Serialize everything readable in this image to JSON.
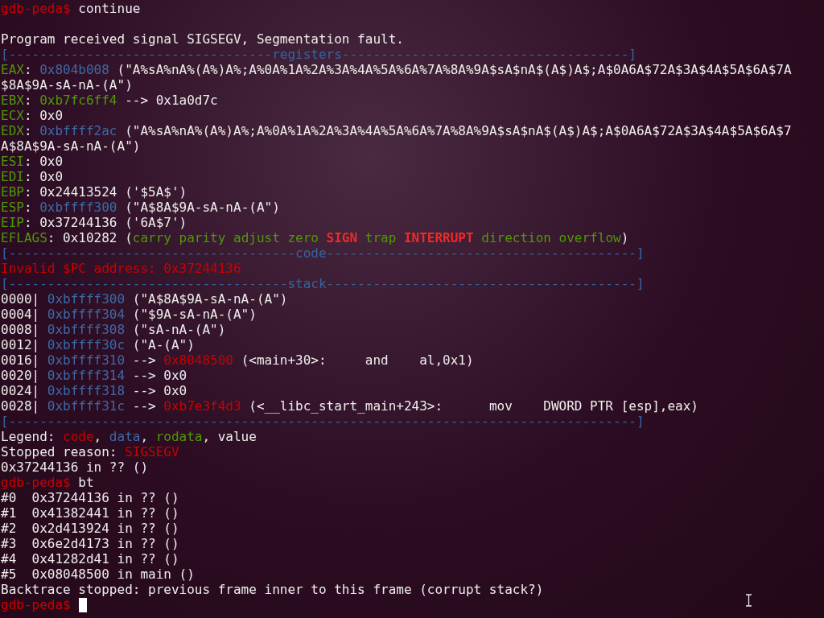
{
  "terminal": {
    "cursor_visible": true,
    "lines": [
      {
        "kind": "text",
        "segments": [
          {
            "kind": "prompt",
            "text": "gdb-peda$"
          },
          {
            "kind": "plain",
            "text": " continue"
          }
        ]
      },
      {
        "kind": "blank"
      },
      {
        "kind": "text",
        "segments": [
          {
            "kind": "plain",
            "text": "Program received signal SIGSEGV, Segmentation fault."
          }
        ]
      },
      {
        "kind": "text",
        "segments": [
          {
            "kind": "ruler",
            "text": "[----------------------------------registers-------------------------------------]"
          }
        ]
      },
      {
        "kind": "text",
        "segments": [
          {
            "kind": "rodata",
            "text": "EAX"
          },
          {
            "kind": "plain",
            "text": ": "
          },
          {
            "kind": "data",
            "text": "0x804b008"
          },
          {
            "kind": "plain",
            "text": " (\"A%sA%nA%(A%)A%;A%0A%1A%2A%3A%4A%5A%6A%7A%8A%9A$sA$nA$(A$)A$;A$0A6A$72A$3A$4A$5A$6A$7A"
          }
        ]
      },
      {
        "kind": "text",
        "segments": [
          {
            "kind": "plain",
            "text": "$8A$9A-sA-nA-(A\")"
          }
        ]
      },
      {
        "kind": "text",
        "segments": [
          {
            "kind": "rodata",
            "text": "EBX"
          },
          {
            "kind": "plain",
            "text": ": "
          },
          {
            "kind": "rodata",
            "text": "0xb7fc6ff4"
          },
          {
            "kind": "plain",
            "text": " --> 0x1a0d7c"
          }
        ]
      },
      {
        "kind": "text",
        "segments": [
          {
            "kind": "rodata",
            "text": "ECX"
          },
          {
            "kind": "plain",
            "text": ": 0x0"
          }
        ]
      },
      {
        "kind": "text",
        "segments": [
          {
            "kind": "rodata",
            "text": "EDX"
          },
          {
            "kind": "plain",
            "text": ": "
          },
          {
            "kind": "data",
            "text": "0xbffff2ac"
          },
          {
            "kind": "plain",
            "text": " (\"A%sA%nA%(A%)A%;A%0A%1A%2A%3A%4A%5A%6A%7A%8A%9A$sA$nA$(A$)A$;A$0A6A$72A$3A$4A$5A$6A$7"
          }
        ]
      },
      {
        "kind": "text",
        "segments": [
          {
            "kind": "plain",
            "text": "A$8A$9A-sA-nA-(A\")"
          }
        ]
      },
      {
        "kind": "text",
        "segments": [
          {
            "kind": "rodata",
            "text": "ESI"
          },
          {
            "kind": "plain",
            "text": ": 0x0"
          }
        ]
      },
      {
        "kind": "text",
        "segments": [
          {
            "kind": "rodata",
            "text": "EDI"
          },
          {
            "kind": "plain",
            "text": ": 0x0"
          }
        ]
      },
      {
        "kind": "text",
        "segments": [
          {
            "kind": "rodata",
            "text": "EBP"
          },
          {
            "kind": "plain",
            "text": ": 0x24413524 ('$5A$')"
          }
        ]
      },
      {
        "kind": "text",
        "segments": [
          {
            "kind": "rodata",
            "text": "ESP"
          },
          {
            "kind": "plain",
            "text": ": "
          },
          {
            "kind": "data",
            "text": "0xbffff300"
          },
          {
            "kind": "plain",
            "text": " (\"A$8A$9A-sA-nA-(A\")"
          }
        ]
      },
      {
        "kind": "text",
        "segments": [
          {
            "kind": "rodata",
            "text": "EIP"
          },
          {
            "kind": "plain",
            "text": ": 0x37244136 ('6A$7')"
          }
        ]
      },
      {
        "kind": "text",
        "segments": [
          {
            "kind": "rodata",
            "text": "EFLAGS"
          },
          {
            "kind": "plain",
            "text": ": 0x10282 ("
          },
          {
            "kind": "rodata",
            "text": "carry parity adjust zero "
          },
          {
            "kind": "alert",
            "text": "SIGN"
          },
          {
            "kind": "rodata",
            "text": " trap "
          },
          {
            "kind": "alert",
            "text": "INTERRUPT"
          },
          {
            "kind": "rodata",
            "text": " direction overflow"
          },
          {
            "kind": "plain",
            "text": ")"
          }
        ]
      },
      {
        "kind": "text",
        "segments": [
          {
            "kind": "ruler",
            "text": "[-------------------------------------code----------------------------------------]"
          }
        ]
      },
      {
        "kind": "text",
        "segments": [
          {
            "kind": "code",
            "text": "Invalid $PC address: 0x37244136"
          }
        ]
      },
      {
        "kind": "text",
        "segments": [
          {
            "kind": "ruler",
            "text": "[------------------------------------stack----------------------------------------]"
          }
        ]
      },
      {
        "kind": "text",
        "segments": [
          {
            "kind": "plain",
            "text": "0000| "
          },
          {
            "kind": "data",
            "text": "0xbffff300"
          },
          {
            "kind": "plain",
            "text": " (\"A$8A$9A-sA-nA-(A\")"
          }
        ]
      },
      {
        "kind": "text",
        "segments": [
          {
            "kind": "plain",
            "text": "0004| "
          },
          {
            "kind": "data",
            "text": "0xbffff304"
          },
          {
            "kind": "plain",
            "text": " (\"$9A-sA-nA-(A\")"
          }
        ]
      },
      {
        "kind": "text",
        "segments": [
          {
            "kind": "plain",
            "text": "0008| "
          },
          {
            "kind": "data",
            "text": "0xbffff308"
          },
          {
            "kind": "plain",
            "text": " (\"sA-nA-(A\")"
          }
        ]
      },
      {
        "kind": "text",
        "segments": [
          {
            "kind": "plain",
            "text": "0012| "
          },
          {
            "kind": "data",
            "text": "0xbffff30c"
          },
          {
            "kind": "plain",
            "text": " (\"A-(A\")"
          }
        ]
      },
      {
        "kind": "text",
        "segments": [
          {
            "kind": "plain",
            "text": "0016| "
          },
          {
            "kind": "data",
            "text": "0xbffff310"
          },
          {
            "kind": "plain",
            "text": " --> "
          },
          {
            "kind": "code",
            "text": "0x8048500"
          },
          {
            "kind": "plain",
            "text": " (<main+30>:\t and    al,0x1)"
          }
        ]
      },
      {
        "kind": "text",
        "segments": [
          {
            "kind": "plain",
            "text": "0020| "
          },
          {
            "kind": "data",
            "text": "0xbffff314"
          },
          {
            "kind": "plain",
            "text": " --> 0x0"
          }
        ]
      },
      {
        "kind": "text",
        "segments": [
          {
            "kind": "plain",
            "text": "0024| "
          },
          {
            "kind": "data",
            "text": "0xbffff318"
          },
          {
            "kind": "plain",
            "text": " --> 0x0"
          }
        ]
      },
      {
        "kind": "text",
        "segments": [
          {
            "kind": "plain",
            "text": "0028| "
          },
          {
            "kind": "data",
            "text": "0xbffff31c"
          },
          {
            "kind": "plain",
            "text": " --> "
          },
          {
            "kind": "code",
            "text": "0xb7e3f4d3"
          },
          {
            "kind": "plain",
            "text": " (<__libc_start_main+243>:\tmov    DWORD PTR [esp],eax)"
          }
        ]
      },
      {
        "kind": "text",
        "segments": [
          {
            "kind": "ruler",
            "text": "[---------------------------------------------------------------------------------]"
          }
        ]
      },
      {
        "kind": "text",
        "segments": [
          {
            "kind": "plain",
            "text": "Legend: "
          },
          {
            "kind": "code",
            "text": "code"
          },
          {
            "kind": "plain",
            "text": ", "
          },
          {
            "kind": "data",
            "text": "data"
          },
          {
            "kind": "plain",
            "text": ", "
          },
          {
            "kind": "rodata",
            "text": "rodata"
          },
          {
            "kind": "plain",
            "text": ", value"
          }
        ]
      },
      {
        "kind": "text",
        "segments": [
          {
            "kind": "plain",
            "text": "Stopped reason: "
          },
          {
            "kind": "code",
            "text": "SIGSEGV"
          }
        ]
      },
      {
        "kind": "text",
        "segments": [
          {
            "kind": "plain",
            "text": "0x37244136 in ?? ()"
          }
        ]
      },
      {
        "kind": "text",
        "segments": [
          {
            "kind": "prompt",
            "text": "gdb-peda$"
          },
          {
            "kind": "plain",
            "text": " bt"
          }
        ]
      },
      {
        "kind": "text",
        "segments": [
          {
            "kind": "plain",
            "text": "#0  0x37244136 in ?? ()"
          }
        ]
      },
      {
        "kind": "text",
        "segments": [
          {
            "kind": "plain",
            "text": "#1  0x41382441 in ?? ()"
          }
        ]
      },
      {
        "kind": "text",
        "segments": [
          {
            "kind": "plain",
            "text": "#2  0x2d413924 in ?? ()"
          }
        ]
      },
      {
        "kind": "text",
        "segments": [
          {
            "kind": "plain",
            "text": "#3  0x6e2d4173 in ?? ()"
          }
        ]
      },
      {
        "kind": "text",
        "segments": [
          {
            "kind": "plain",
            "text": "#4  0x41282d41 in ?? ()"
          }
        ]
      },
      {
        "kind": "text",
        "segments": [
          {
            "kind": "plain",
            "text": "#5  0x08048500 in main ()"
          }
        ]
      },
      {
        "kind": "text",
        "segments": [
          {
            "kind": "plain",
            "text": "Backtrace stopped: previous frame inner to this frame (corrupt stack?)"
          }
        ]
      },
      {
        "kind": "text",
        "segments": [
          {
            "kind": "prompt",
            "text": "gdb-peda$"
          }
        ]
      }
    ]
  }
}
